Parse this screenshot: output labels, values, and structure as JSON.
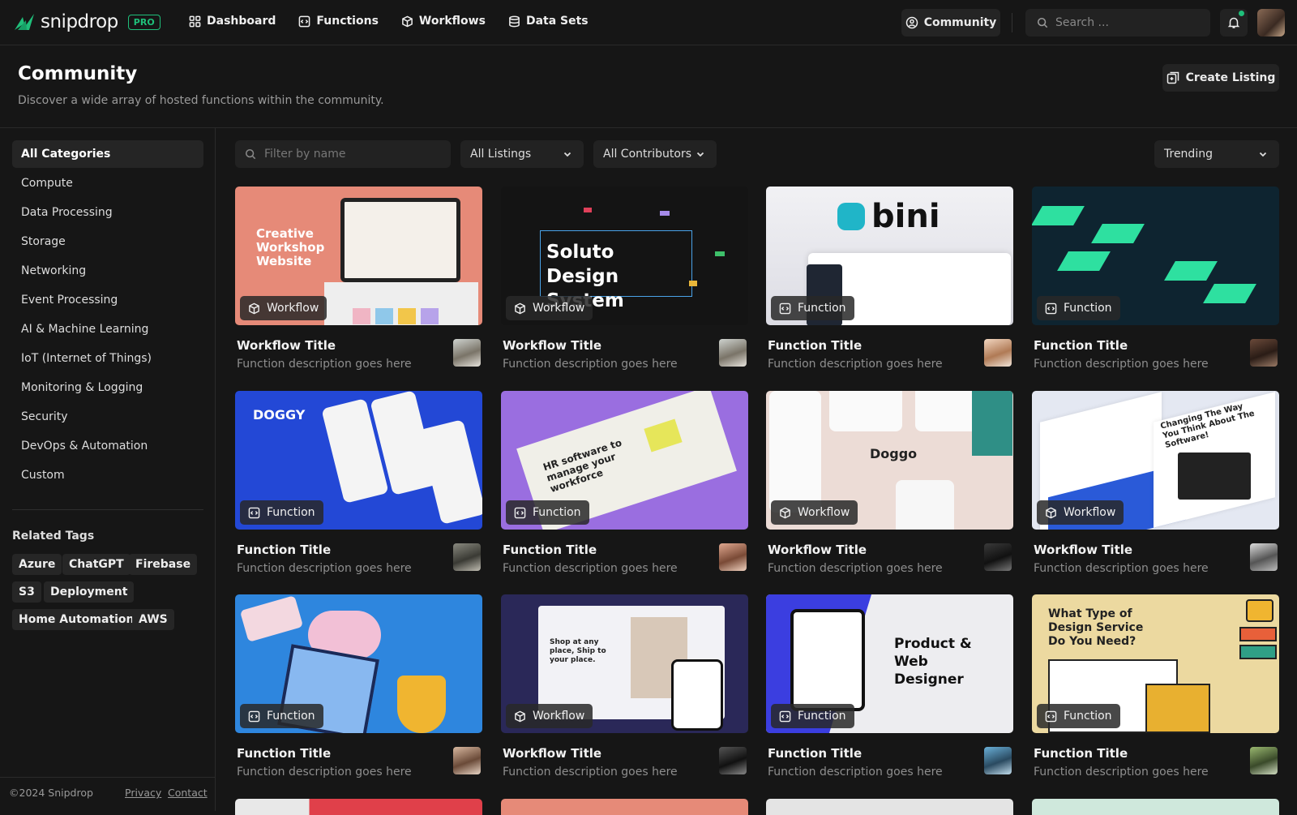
{
  "app": {
    "name": "snipdrop",
    "plan_badge": "PRO"
  },
  "nav": [
    {
      "label": "Dashboard",
      "icon": "grid-icon"
    },
    {
      "label": "Functions",
      "icon": "code-square-icon"
    },
    {
      "label": "Workflows",
      "icon": "cube-icon"
    },
    {
      "label": "Data Sets",
      "icon": "database-icon"
    }
  ],
  "topbar": {
    "community_label": "Community",
    "search_placeholder": "Search ..."
  },
  "header": {
    "title": "Community",
    "subtitle": "Discover a wide array of hosted functions within the community.",
    "create_label": "Create Listing"
  },
  "sidebar": {
    "categories": [
      "All Categories",
      "Compute",
      "Data Processing",
      "Storage",
      "Networking",
      "Event Processing",
      "AI & Machine Learning",
      "IoT (Internet of Things)",
      "Monitoring & Logging",
      "Security",
      "DevOps & Automation",
      "Custom"
    ],
    "tags_title": "Related Tags",
    "tags": [
      "Azure",
      "ChatGPT",
      "Firebase",
      "S3",
      "Deployment",
      "Home Automation",
      "AWS"
    ],
    "footer": {
      "copyright": "©2024 Snipdrop",
      "privacy": "Privacy",
      "contact": "Contact"
    }
  },
  "filters": {
    "name_placeholder": "Filter by name",
    "listings": "All Listings",
    "contributors": "All Contributors",
    "sort": "Trending"
  },
  "cards": [
    {
      "type": "Workflow",
      "title": "Workflow Title",
      "desc": "Function description goes here",
      "thumb_text": "Creative Workshop Website"
    },
    {
      "type": "Workflow",
      "title": "Workflow Title",
      "desc": "Function description goes here",
      "thumb_text": "Soluto Design System"
    },
    {
      "type": "Function",
      "title": "Function Title",
      "desc": "Function description goes here",
      "thumb_text": "bini"
    },
    {
      "type": "Function",
      "title": "Function Title",
      "desc": "Function description goes here",
      "thumb_text": ""
    },
    {
      "type": "Function",
      "title": "Function Title",
      "desc": "Function description goes here",
      "thumb_text": "DOGGY"
    },
    {
      "type": "Function",
      "title": "Function Title",
      "desc": "Function description goes here",
      "thumb_text": "HR software to manage your workforce"
    },
    {
      "type": "Workflow",
      "title": "Workflow Title",
      "desc": "Function description goes here",
      "thumb_text": "Doggo"
    },
    {
      "type": "Workflow",
      "title": "Workflow Title",
      "desc": "Function description goes here",
      "thumb_text": "Changing The Way You Think About The Software!"
    },
    {
      "type": "Function",
      "title": "Function Title",
      "desc": "Function description goes here",
      "thumb_text": ""
    },
    {
      "type": "Workflow",
      "title": "Workflow Title",
      "desc": "Function description goes here",
      "thumb_text": "Shop at any place, Ship to your place."
    },
    {
      "type": "Function",
      "title": "Function Title",
      "desc": "Function description goes here",
      "thumb_text": "Product & Web Designer"
    },
    {
      "type": "Function",
      "title": "Function Title",
      "desc": "Function description goes here",
      "thumb_text": "What Type of Design Service Do You Need?"
    }
  ],
  "colors": {
    "accent": "#1fbf7a",
    "background": "#161616",
    "surface": "#222222"
  }
}
